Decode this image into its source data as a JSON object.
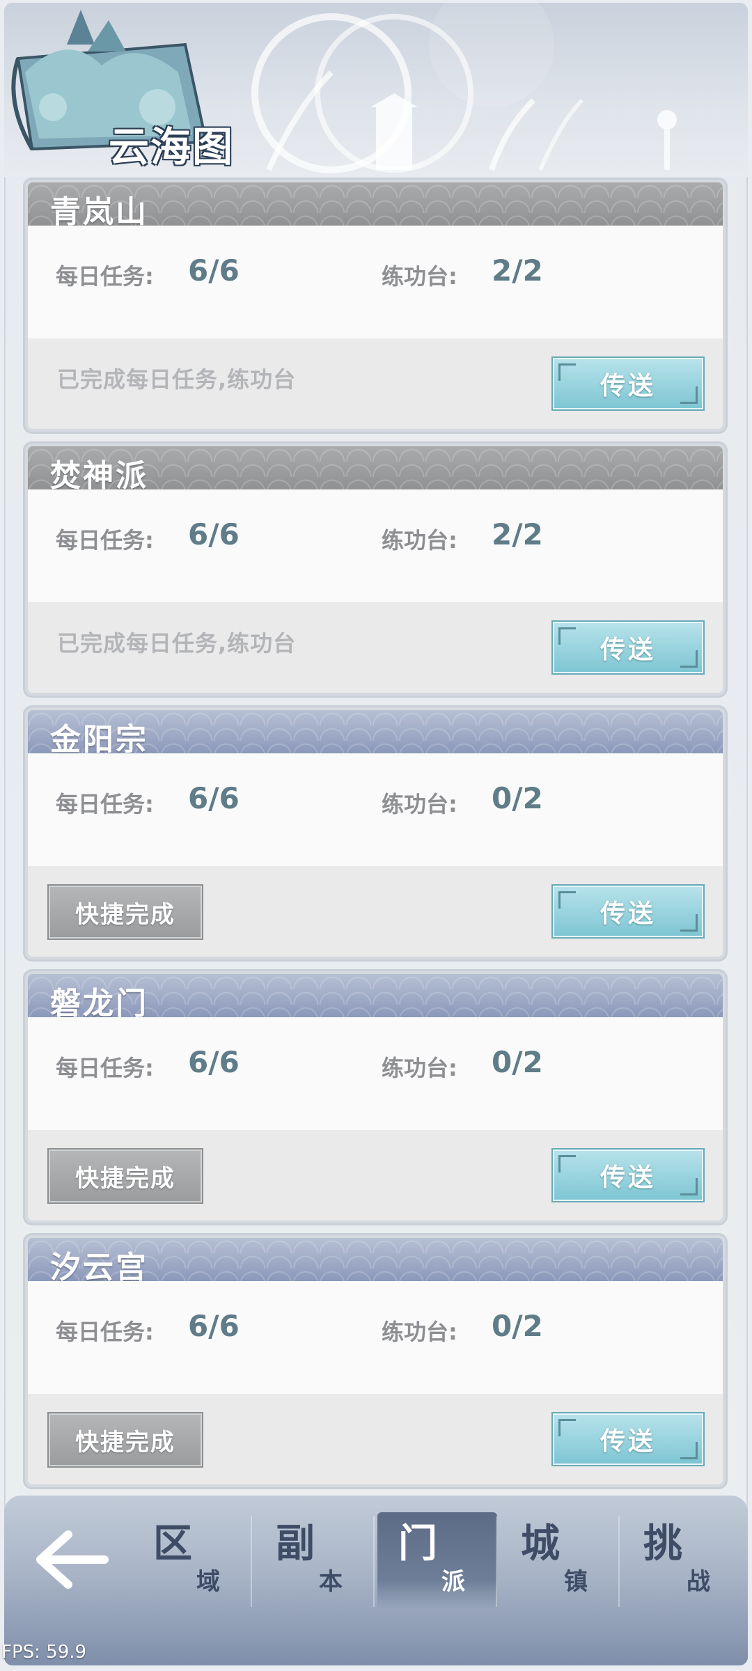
{
  "header": {
    "title": "云海图"
  },
  "cards": [
    {
      "name": "青岚山",
      "theme": "gray",
      "daily_label": "每日任务:",
      "daily_value": "6/6",
      "practice_label": "练功台:",
      "practice_value": "2/2",
      "status": "已完成每日任务,练功台",
      "quick_label": null,
      "teleport_label": "传送"
    },
    {
      "name": "焚神派",
      "theme": "gray",
      "daily_label": "每日任务:",
      "daily_value": "6/6",
      "practice_label": "练功台:",
      "practice_value": "2/2",
      "status": "已完成每日任务,练功台",
      "quick_label": null,
      "teleport_label": "传送"
    },
    {
      "name": "金阳宗",
      "theme": "blue",
      "daily_label": "每日任务:",
      "daily_value": "6/6",
      "practice_label": "练功台:",
      "practice_value": "0/2",
      "status": null,
      "quick_label": "快捷完成",
      "teleport_label": "传送"
    },
    {
      "name": "磐龙门",
      "theme": "blue",
      "daily_label": "每日任务:",
      "daily_value": "6/6",
      "practice_label": "练功台:",
      "practice_value": "0/2",
      "status": null,
      "quick_label": "快捷完成",
      "teleport_label": "传送"
    },
    {
      "name": "汐云宫",
      "theme": "blue",
      "daily_label": "每日任务:",
      "daily_value": "6/6",
      "practice_label": "练功台:",
      "practice_value": "0/2",
      "status": null,
      "quick_label": "快捷完成",
      "teleport_label": "传送"
    }
  ],
  "bottom_nav": {
    "back_icon": "arrow-left-icon",
    "tabs": [
      {
        "big": "区",
        "small": "域",
        "active": false
      },
      {
        "big": "副",
        "small": "本",
        "active": false
      },
      {
        "big": "门",
        "small": "派",
        "active": true
      },
      {
        "big": "城",
        "small": "镇",
        "active": false
      },
      {
        "big": "挑",
        "small": "战",
        "active": false
      }
    ]
  },
  "fps": "FPS: 59.9",
  "colors": {
    "value_text": "#5f7c88",
    "teleport_button": "#7ec6d3",
    "active_tab": "#5d6b86"
  }
}
